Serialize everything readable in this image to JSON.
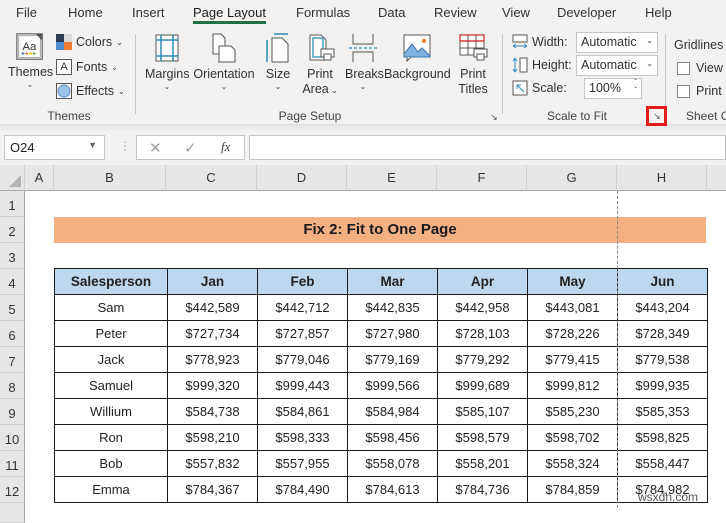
{
  "menu": {
    "tabs": [
      "File",
      "Home",
      "Insert",
      "Page Layout",
      "Formulas",
      "Data",
      "Review",
      "View",
      "Developer",
      "Help"
    ],
    "active": "Page Layout"
  },
  "ribbon": {
    "themes_group": {
      "label": "Themes",
      "themes_button": "Themes",
      "colors": "Colors",
      "fonts": "Fonts",
      "effects": "Effects"
    },
    "page_setup_group": {
      "label": "Page Setup",
      "margins": "Margins",
      "orientation": "Orientation",
      "size": "Size",
      "print_area_line1": "Print",
      "print_area_line2": "Area",
      "breaks": "Breaks",
      "background": "Background",
      "print_titles_line1": "Print",
      "print_titles_line2": "Titles"
    },
    "scale_to_fit_group": {
      "label": "Scale to Fit",
      "width_label": "Width:",
      "width_value": "Automatic",
      "height_label": "Height:",
      "height_value": "Automatic",
      "scale_label": "Scale:",
      "scale_value": "100%"
    },
    "sheet_options_group": {
      "label": "Sheet O",
      "gridlines": "Gridlines",
      "view": "View",
      "print": "Print"
    }
  },
  "formula_bar": {
    "name_box": "O24",
    "fx": "fx",
    "formula": ""
  },
  "sheet": {
    "columns": [
      "A",
      "B",
      "C",
      "D",
      "E",
      "F",
      "G",
      "H"
    ],
    "rows": [
      "1",
      "2",
      "3",
      "4",
      "5",
      "6",
      "7",
      "8",
      "9",
      "10",
      "11",
      "12"
    ],
    "title": "Fix 2: Fit to One Page",
    "table": {
      "headers": [
        "Salesperson",
        "Jan",
        "Feb",
        "Mar",
        "Apr",
        "May",
        "Jun"
      ],
      "rows": [
        [
          "Sam",
          "$442,589",
          "$442,712",
          "$442,835",
          "$442,958",
          "$443,081",
          "$443,204"
        ],
        [
          "Peter",
          "$727,734",
          "$727,857",
          "$727,980",
          "$728,103",
          "$728,226",
          "$728,349"
        ],
        [
          "Jack",
          "$778,923",
          "$779,046",
          "$779,169",
          "$779,292",
          "$779,415",
          "$779,538"
        ],
        [
          "Samuel",
          "$999,320",
          "$999,443",
          "$999,566",
          "$999,689",
          "$999,812",
          "$999,935"
        ],
        [
          "Willium",
          "$584,738",
          "$584,861",
          "$584,984",
          "$585,107",
          "$585,230",
          "$585,353"
        ],
        [
          "Ron",
          "$598,210",
          "$598,333",
          "$598,456",
          "$598,579",
          "$598,702",
          "$598,825"
        ],
        [
          "Bob",
          "$557,832",
          "$557,955",
          "$558,078",
          "$558,201",
          "$558,324",
          "$558,447"
        ],
        [
          "Emma",
          "$784,367",
          "$784,490",
          "$784,613",
          "$784,736",
          "$784,859",
          "$784,982"
        ]
      ]
    }
  },
  "watermark": "wsxdn.com",
  "colors": {
    "accent": "#1e7145",
    "title_fill": "#f4b083",
    "header_fill": "#bdd7ee",
    "highlight": "#e21b1b"
  }
}
